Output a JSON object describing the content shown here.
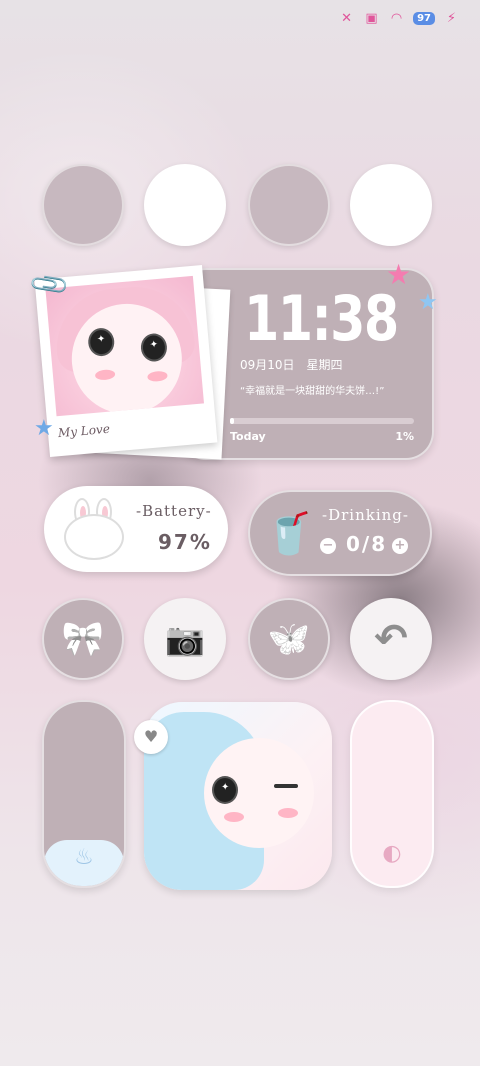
{
  "status_bar": {
    "battery_level": "97",
    "icons": [
      "mute-icon",
      "sim-off-icon",
      "wifi-icon",
      "battery-icon",
      "charging-icon"
    ]
  },
  "top_circles": [
    "gray",
    "white",
    "gray",
    "white"
  ],
  "photo_widget": {
    "caption": "My Love"
  },
  "clock_widget": {
    "time": "11:38",
    "date": "09月10日",
    "weekday": "星期四",
    "quote": "“幸福就是一块甜甜的华夫饼…!”",
    "progress_label": "Today",
    "progress_percent": "1%",
    "progress_value": 0.01
  },
  "battery_widget": {
    "title": "-Battery-",
    "value": "97%"
  },
  "drinking_widget": {
    "title": "-Drinking-",
    "value": "0/8",
    "minus": "−",
    "plus": "+"
  },
  "icon_row": [
    {
      "name": "bow-icon",
      "glyph": "🎀"
    },
    {
      "name": "camera-icon",
      "glyph": "📷"
    },
    {
      "name": "butterfly-icon",
      "glyph": "🦋"
    },
    {
      "name": "back-arrow-icon",
      "glyph": "↶"
    }
  ],
  "bottom": {
    "left_slider_fill": 0.25,
    "cake_icon": "cake-icon",
    "contrast_icon": "contrast-icon",
    "heart_bubble": "♥"
  },
  "colors": {
    "accent_gray": "#bfb0b6",
    "white": "#ffffff",
    "status_pink": "#e0569b",
    "battery_blue": "#5a8de5"
  }
}
